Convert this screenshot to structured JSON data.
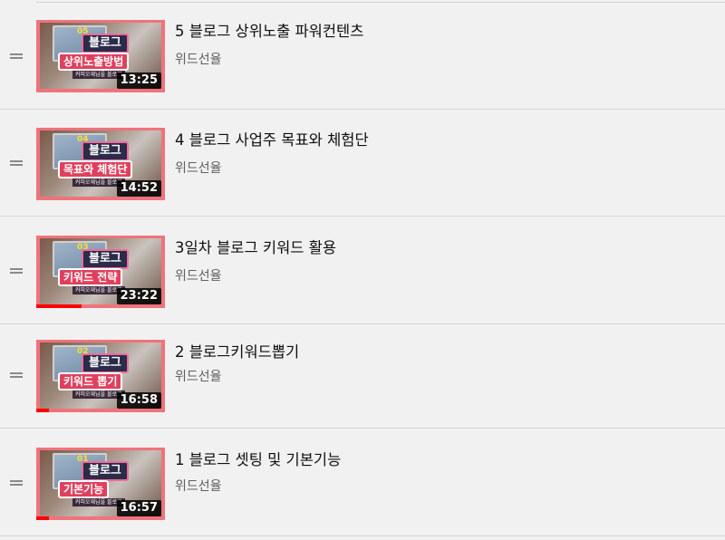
{
  "playlist": {
    "items": [
      {
        "title": "5 블로그 상위노출 파워컨텐츠",
        "channel": "위드선율",
        "duration": "13:25",
        "thumb_num": "05",
        "thumb_top": "블로그",
        "thumb_main": "상위노출방법",
        "thumb_sub": "커피오재님을 블로그",
        "watched_fraction": 0
      },
      {
        "title": "4 블로그 사업주 목표와 체험단",
        "channel": "위드선율",
        "duration": "14:52",
        "thumb_num": "04",
        "thumb_top": "블로그",
        "thumb_main": "목표와 체험단",
        "thumb_sub": "커피오재님을 블로그",
        "watched_fraction": 0
      },
      {
        "title": "3일차 블로그 키워드 활용",
        "channel": "위드선율",
        "duration": "23:22",
        "thumb_num": "03",
        "thumb_top": "블로그",
        "thumb_main": "키워드 전략",
        "thumb_sub": "커피오재님을 블로그",
        "watched_fraction": 0.35
      },
      {
        "title": "2 블로그키워드뽑기",
        "channel": "위드선율",
        "duration": "16:58",
        "thumb_num": "02",
        "thumb_top": "블로그",
        "thumb_main": "키워드 뽑기",
        "thumb_sub": "커피오재님을 블로그",
        "watched_fraction": 0.1
      },
      {
        "title": "1 블로그 셋팅 및 기본기능",
        "channel": "위드선율",
        "duration": "16:57",
        "thumb_num": "01",
        "thumb_top": "블로그",
        "thumb_main": "기본기능",
        "thumb_sub": "커피오재님을 블로그",
        "watched_fraction": 0.1
      }
    ]
  },
  "colors": {
    "thumb_frame": "#f0737b",
    "progress": "#ff0000",
    "title": "#0f0f0f",
    "channel": "#606060",
    "background": "#f1f1f1"
  },
  "icons": {
    "handle": "drag-handle-icon"
  }
}
